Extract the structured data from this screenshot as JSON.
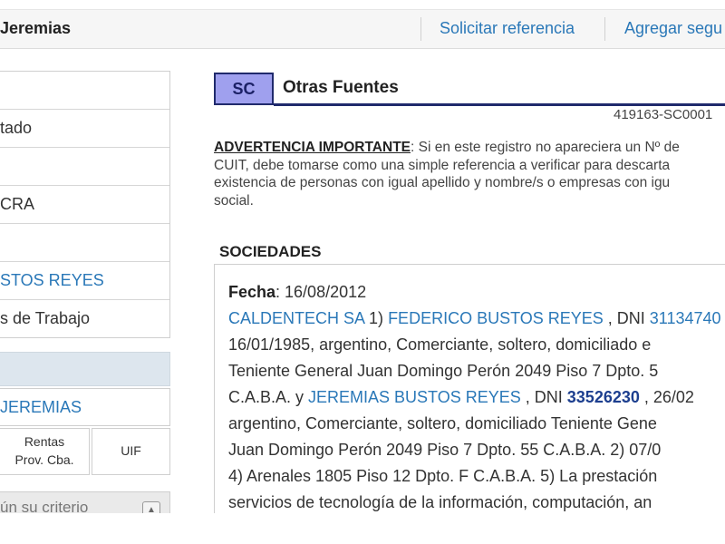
{
  "header": {
    "name": "Jeremias",
    "request_reference": "Solicitar referencia",
    "add_follow": "Agregar segu"
  },
  "sidebar": {
    "items": [
      {
        "label": ""
      },
      {
        "label": "tado"
      },
      {
        "label": ""
      },
      {
        "label": "CRA"
      },
      {
        "label": ""
      },
      {
        "label": "STOS REYES"
      },
      {
        "label": "s de Trabajo"
      }
    ],
    "selected_person": "JEREMIAS",
    "buttons": [
      {
        "label": "Rentas\nProv. Cba."
      },
      {
        "label": "UIF"
      }
    ],
    "search_placeholder": "ún su criterio"
  },
  "section": {
    "badge": "SC",
    "title": "Otras Fuentes",
    "code": "419163-SC0001"
  },
  "warning": {
    "title": "ADVERTENCIA IMPORTANTE",
    "line1": ": Si en este registro no apareciera un Nº de",
    "line2": "CUIT, debe tomarse como una simple referencia a verificar para descarta",
    "line3": "existencia de personas con igual apellido y nombre/s o empresas con igu",
    "line4": "social."
  },
  "societies": {
    "heading": "SOCIEDADES",
    "date_label": "Fecha",
    "date_value": ": 16/08/2012",
    "company": "CALDENTECH SA",
    "p1_prefix": " 1) ",
    "person1": "FEDERICO BUSTOS REYES",
    "dni_text1": " , DNI ",
    "dni1": "31134740",
    "line2": "16/01/1985, argentino, Comerciante, soltero, domiciliado e",
    "line3": "Teniente General Juan Domingo Perón 2049 Piso 7 Dpto. 5",
    "line4_prefix": "C.A.B.A. y ",
    "person2": "JEREMIAS BUSTOS REYES",
    "dni_text2": " , DNI ",
    "dni2": "33526230",
    "line4_suffix": " , 26/02",
    "line5": "argentino, Comerciante, soltero, domiciliado Teniente Gene",
    "line6": "Juan Domingo Perón 2049 Piso 7 Dpto. 55 C.A.B.A. 2) 07/0",
    "line7": "4) Arenales 1805 Piso 12 Dpto. F C.A.B.A. 5) La prestación",
    "line8": "servicios de tecnología de la información, computación, an"
  }
}
